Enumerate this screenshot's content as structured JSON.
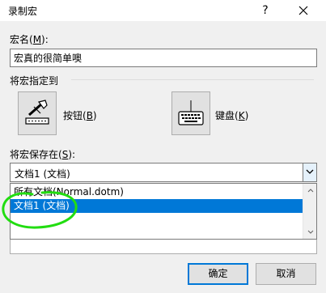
{
  "window": {
    "title": "录制宏",
    "help_glyph": "?"
  },
  "macro_name": {
    "label_text": "宏名(",
    "label_key": "M",
    "label_tail": "):",
    "value": "宏真的很简单噢"
  },
  "assign": {
    "group_label": "将宏指定到",
    "button_label_text": "按钮(",
    "button_label_key": "B",
    "button_label_tail": ")",
    "keyboard_label_text": "键盘(",
    "keyboard_label_key": "K",
    "keyboard_label_tail": ")",
    "button_icon": "macro-button-icon",
    "keyboard_icon": "keyboard-icon"
  },
  "store": {
    "label_text": "将宏保存在(",
    "label_key": "S",
    "label_tail": "):",
    "selected_value": "文档1 (文档)",
    "options": [
      "所有文档(Normal.dotm)",
      "文档1 (文档)"
    ],
    "highlighted_option_index": 1
  },
  "footer": {
    "ok_label": "确定",
    "cancel_label": "取消"
  },
  "colors": {
    "selection": "#0078d7",
    "annotation": "#22dd11",
    "dialog_bg": "#f0f0f0"
  }
}
